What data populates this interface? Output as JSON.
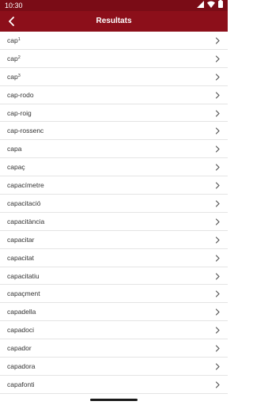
{
  "status_bar": {
    "time": "10:30",
    "icons": [
      "signal-icon",
      "wifi-icon",
      "battery-icon"
    ]
  },
  "app_bar": {
    "title": "Resultats",
    "back_icon": "back-arrow-icon"
  },
  "results": [
    {
      "label": "cap",
      "sup": "1"
    },
    {
      "label": "cap",
      "sup": "2"
    },
    {
      "label": "cap",
      "sup": "3"
    },
    {
      "label": "cap-rodo",
      "sup": ""
    },
    {
      "label": "cap-roig",
      "sup": ""
    },
    {
      "label": "cap-rossenc",
      "sup": ""
    },
    {
      "label": "capa",
      "sup": ""
    },
    {
      "label": "capaç",
      "sup": ""
    },
    {
      "label": "capacímetre",
      "sup": ""
    },
    {
      "label": "capacitació",
      "sup": ""
    },
    {
      "label": "capacitància",
      "sup": ""
    },
    {
      "label": "capacitar",
      "sup": ""
    },
    {
      "label": "capacitat",
      "sup": ""
    },
    {
      "label": "capacitatiu",
      "sup": ""
    },
    {
      "label": "capaçment",
      "sup": ""
    },
    {
      "label": "capadella",
      "sup": ""
    },
    {
      "label": "capadoci",
      "sup": ""
    },
    {
      "label": "capador",
      "sup": ""
    },
    {
      "label": "capadora",
      "sup": ""
    },
    {
      "label": "capafonti",
      "sup": ""
    }
  ],
  "colors": {
    "status_bar": "#7a0c16",
    "app_bar": "#8c0f1a",
    "chevron": "#555555"
  }
}
